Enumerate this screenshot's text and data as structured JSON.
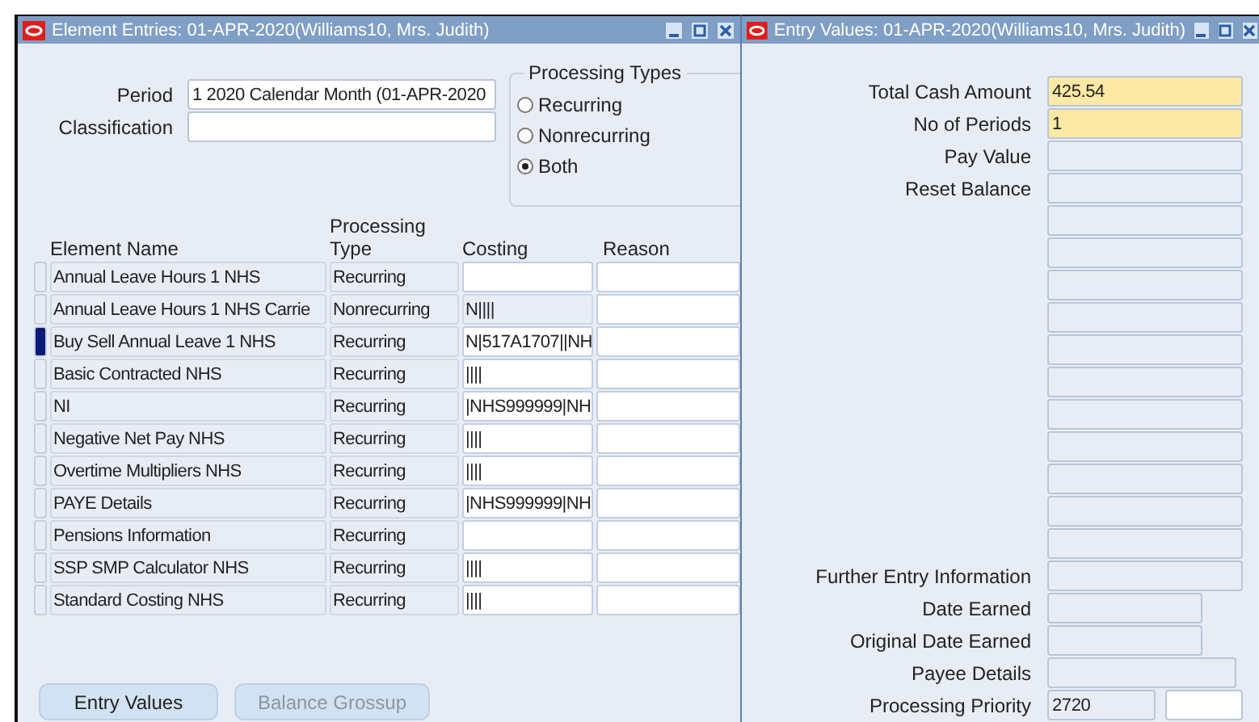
{
  "element_entries": {
    "title": "Element Entries: 01-APR-2020(Williams10, Mrs. Judith)",
    "period": {
      "label": "Period",
      "value": "1 2020 Calendar Month (01-APR-2020"
    },
    "classification": {
      "label": "Classification"
    },
    "processing_types": {
      "title": "Processing Types",
      "options": [
        {
          "label": "Recurring",
          "selected": false
        },
        {
          "label": "Nonrecurring",
          "selected": false
        },
        {
          "label": "Both",
          "selected": true
        }
      ]
    },
    "table": {
      "columns": [
        "Element Name",
        "Processing Type",
        "Costing",
        "Reason"
      ],
      "rows": [
        {
          "name": "Annual Leave Hours 1 NHS",
          "type": "Recurring",
          "costing": "",
          "costing_editable": true,
          "selected": false
        },
        {
          "name": "Annual Leave Hours 1 NHS Carrie",
          "type": "Nonrecurring",
          "costing": "N||||",
          "costing_editable": false,
          "selected": false
        },
        {
          "name": "Buy Sell Annual Leave 1 NHS",
          "type": "Recurring",
          "costing": "N|517A1707||NH",
          "costing_editable": true,
          "selected": true
        },
        {
          "name": "Basic Contracted NHS",
          "type": "Recurring",
          "costing": "||||",
          "costing_editable": true,
          "selected": false
        },
        {
          "name": "NI",
          "type": "Recurring",
          "costing": "|NHS999999|NH",
          "costing_editable": true,
          "selected": false
        },
        {
          "name": "Negative Net Pay NHS",
          "type": "Recurring",
          "costing": "||||",
          "costing_editable": true,
          "selected": false
        },
        {
          "name": "Overtime Multipliers NHS",
          "type": "Recurring",
          "costing": "||||",
          "costing_editable": true,
          "selected": false
        },
        {
          "name": "PAYE Details",
          "type": "Recurring",
          "costing": "|NHS999999|NH",
          "costing_editable": true,
          "selected": false
        },
        {
          "name": "Pensions Information",
          "type": "Recurring",
          "costing": "",
          "costing_editable": true,
          "selected": false
        },
        {
          "name": "SSP SMP Calculator NHS",
          "type": "Recurring",
          "costing": "||||",
          "costing_editable": true,
          "selected": false
        },
        {
          "name": "Standard Costing NHS",
          "type": "Recurring",
          "costing": "||||",
          "costing_editable": true,
          "selected": false
        }
      ]
    },
    "buttons": [
      {
        "label": "Entry Values",
        "disabled": false
      },
      {
        "label": "Balance Grossup",
        "disabled": true
      }
    ]
  },
  "entry_values": {
    "title": "Entry Values: 01-APR-2020(Williams10, Mrs. Judith)",
    "fields": [
      {
        "kind": "full",
        "label": "Total Cash Amount",
        "value": "425.54",
        "required": true
      },
      {
        "kind": "full",
        "label": "No of Periods",
        "value": "1",
        "required": true
      },
      {
        "kind": "full",
        "label": "Pay Value",
        "required": false
      },
      {
        "kind": "full",
        "label": "Reset Balance",
        "required": false
      },
      {
        "kind": "full",
        "required": false
      },
      {
        "kind": "full",
        "required": false
      },
      {
        "kind": "full",
        "required": false
      },
      {
        "kind": "full",
        "required": false
      },
      {
        "kind": "full",
        "required": false
      },
      {
        "kind": "full",
        "required": false
      },
      {
        "kind": "full",
        "required": false
      },
      {
        "kind": "full",
        "required": false
      },
      {
        "kind": "full",
        "required": false
      },
      {
        "kind": "full",
        "required": false
      },
      {
        "kind": "full",
        "required": false
      },
      {
        "kind": "full",
        "label": "Further Entry Information",
        "required": false
      },
      {
        "kind": "short",
        "label": "Date Earned",
        "required": false
      },
      {
        "kind": "short",
        "label": "Original Date Earned",
        "required": false
      },
      {
        "kind": "medium",
        "label": "Payee Details",
        "required": false
      },
      {
        "kind": "split",
        "label": "Processing Priority",
        "value": "2720",
        "required": false
      }
    ]
  }
}
